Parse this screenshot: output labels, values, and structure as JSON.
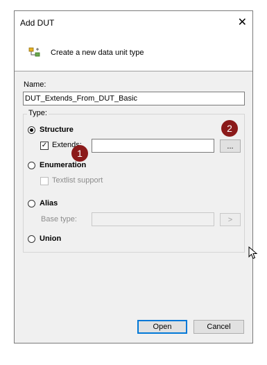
{
  "window": {
    "title": "Add DUT"
  },
  "header": {
    "description": "Create a new data unit type",
    "icon": "dut-icon"
  },
  "name": {
    "label": "Name:",
    "value": "DUT_Extends_From_DUT_Basic"
  },
  "type_group": {
    "label": "Type:",
    "structure": {
      "label": "Structure",
      "checked": true,
      "extends_label": "Extends:",
      "extends_value": "",
      "browse_label": "..."
    },
    "enumeration": {
      "label": "Enumeration",
      "textlist_label": "Textlist support"
    },
    "alias": {
      "label": "Alias",
      "base_type_label": "Base type:",
      "base_type_value": "",
      "arrow_label": ">"
    },
    "union": {
      "label": "Union"
    }
  },
  "buttons": {
    "open": "Open",
    "cancel": "Cancel"
  },
  "annotations": {
    "first": "1",
    "second": "2"
  },
  "colors": {
    "badge": "#8b1a1a",
    "accent": "#0078d7"
  }
}
